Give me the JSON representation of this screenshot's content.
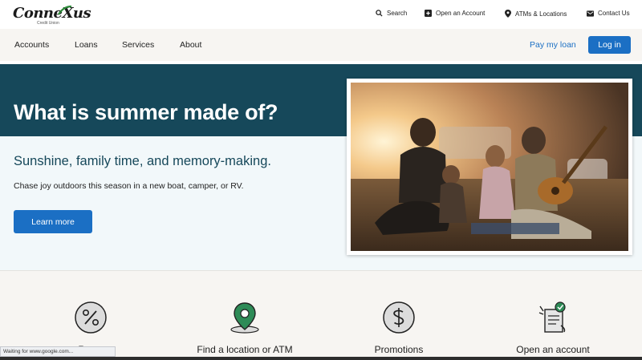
{
  "brand": {
    "name": "ConneXus",
    "tagline": "Credit Union",
    "accent": "#2e8b3a"
  },
  "utility_nav": [
    {
      "label": "Search",
      "icon": "search-icon"
    },
    {
      "label": "Open an Account",
      "icon": "plus-square-icon"
    },
    {
      "label": "ATMs & Locations",
      "icon": "map-pin-icon"
    },
    {
      "label": "Contact Us",
      "icon": "mail-icon"
    }
  ],
  "main_nav": {
    "items": [
      "Accounts",
      "Loans",
      "Services",
      "About"
    ],
    "pay_link": "Pay my loan",
    "login": "Log in"
  },
  "hero": {
    "title": "What is summer made of?",
    "subtitle": "Sunshine, family time, and memory-making.",
    "description": "Chase joy outdoors this season in a new boat, camper, or RV.",
    "cta": "Learn more"
  },
  "features": [
    {
      "label": "Rates",
      "icon": "percent-icon"
    },
    {
      "label": "Find a location or ATM",
      "icon": "location-pin-icon"
    },
    {
      "label": "Promotions",
      "icon": "dollar-icon"
    },
    {
      "label": "Open an account",
      "icon": "document-check-icon"
    }
  ],
  "status": {
    "text": "Waiting for www.google.com..."
  },
  "colors": {
    "primary": "#1b6fc4",
    "hero_band": "#16485a",
    "hero_bg": "#f2f8fa"
  }
}
